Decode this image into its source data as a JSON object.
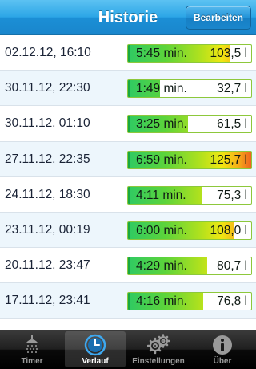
{
  "navbar": {
    "title": "Historie",
    "edit_label": "Bearbeiten"
  },
  "history": [
    {
      "date": "02.12.12, 16:10",
      "duration": "5:45 min.",
      "volume": "103,5 l",
      "level": 103.5
    },
    {
      "date": "30.11.12, 22:30",
      "duration": "1:49 min.",
      "volume": "32,7 l",
      "level": 32.7
    },
    {
      "date": "30.11.12, 01:10",
      "duration": "3:25 min.",
      "volume": "61,5 l",
      "level": 61.5
    },
    {
      "date": "27.11.12, 22:35",
      "duration": "6:59 min.",
      "volume": "125,7 l",
      "level": 125.7
    },
    {
      "date": "24.11.12, 18:30",
      "duration": "4:11 min.",
      "volume": "75,3 l",
      "level": 75.3
    },
    {
      "date": "23.11.12, 00:19",
      "duration": "6:00 min.",
      "volume": "108,0 l",
      "level": 108.0
    },
    {
      "date": "20.11.12, 23:47",
      "duration": "4:29 min.",
      "volume": "80,7 l",
      "level": 80.7
    },
    {
      "date": "17.11.12, 23:41",
      "duration": "4:16 min.",
      "volume": "76,8 l",
      "level": 76.8
    }
  ],
  "max_level": 125.7,
  "tabs": [
    {
      "label": "Timer",
      "icon": "shower-icon",
      "active": false
    },
    {
      "label": "Verlauf",
      "icon": "clock-icon",
      "active": true
    },
    {
      "label": "Einstellungen",
      "icon": "gears-icon",
      "active": false
    },
    {
      "label": "Über",
      "icon": "info-icon",
      "active": false
    }
  ],
  "colors": {
    "nav_blue": "#2ba5e6",
    "bar_green": "#2fca63",
    "bar_yellow": "#f0e712",
    "bar_red": "#ee5a1f",
    "tab_active": "#ffffff"
  }
}
